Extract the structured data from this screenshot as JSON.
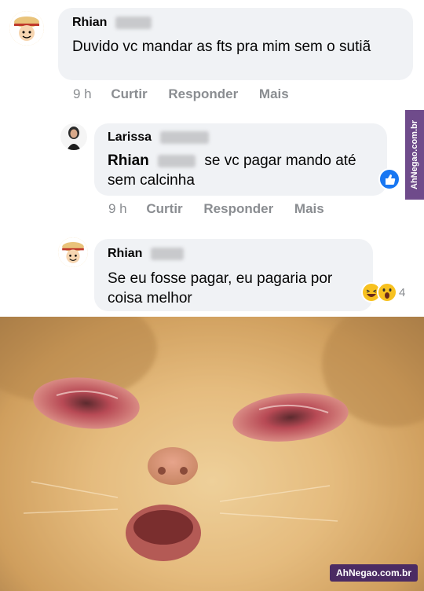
{
  "comments": [
    {
      "author": "Rhian",
      "text": "Duvido vc mandar as fts pra mim sem o sutiã",
      "time": "9 h",
      "like_label": "Curtir",
      "reply_label": "Responder",
      "more_label": "Mais"
    },
    {
      "author": "Larissa",
      "mention": "Rhian",
      "text": "se vc pagar mando até sem calcinha",
      "time": "9 h",
      "like_label": "Curtir",
      "reply_label": "Responder",
      "more_label": "Mais",
      "reaction_icon": "like-icon"
    },
    {
      "author": "Rhian",
      "text": "Se eu fosse pagar, eu pagaria por coisa melhor",
      "reaction_count": "4",
      "reaction_icons": [
        "haha-icon",
        "wow-icon"
      ]
    }
  ],
  "watermark": {
    "side": "AhNegao.com.br",
    "bottom": "AhNegao.com.br"
  },
  "colors": {
    "bubble": "#f0f2f5",
    "like_blue": "#1877f2",
    "reaction_yellow": "#f7c11f"
  }
}
